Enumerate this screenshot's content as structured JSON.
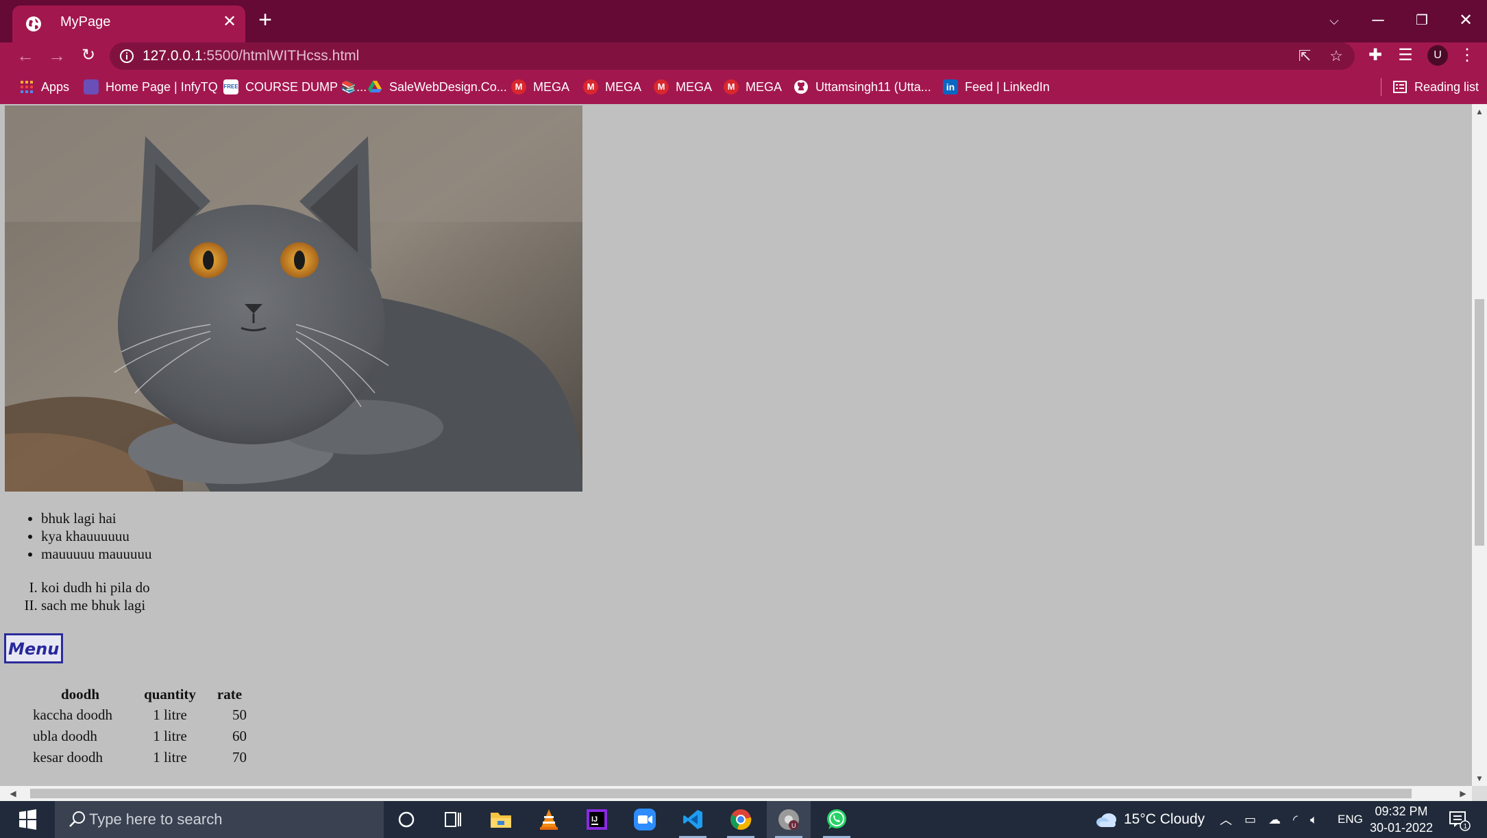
{
  "browser": {
    "tab_title": "MyPage",
    "url_host": "127.0.0.1",
    "url_rest": ":5500/htmlWITHcss.html",
    "theme_color": "#a3174f",
    "bookmarks": [
      {
        "label": "Apps",
        "icon": "apps-grid-icon"
      },
      {
        "label": "Home Page | InfyTQ",
        "icon": "infytq-icon"
      },
      {
        "label": "COURSE DUMP 📚...",
        "icon": "free-badge-icon"
      },
      {
        "label": "SaleWebDesign.Co...",
        "icon": "google-drive-icon"
      },
      {
        "label": "MEGA",
        "icon": "mega-icon"
      },
      {
        "label": "MEGA",
        "icon": "mega-icon"
      },
      {
        "label": "MEGA",
        "icon": "mega-icon"
      },
      {
        "label": "MEGA",
        "icon": "mega-icon"
      },
      {
        "label": "Uttamsingh11 (Utta...",
        "icon": "github-icon"
      },
      {
        "label": "Feed | LinkedIn",
        "icon": "linkedin-icon"
      }
    ],
    "reading_list": "Reading list",
    "profile_initial": "U"
  },
  "page": {
    "background": "#c0c0c0",
    "unordered_list": [
      "bhuk lagi hai",
      "kya khauuuuuu",
      "mauuuuu mauuuuu"
    ],
    "ordered_list": [
      "koi dudh hi pila do",
      "sach me bhuk lagi"
    ],
    "menu_heading": "Menu",
    "table": {
      "headers": [
        "doodh",
        "quantity",
        "rate"
      ],
      "rows": [
        [
          "kaccha doodh",
          "1 litre",
          "50"
        ],
        [
          "ubla doodh",
          "1 litre",
          "60"
        ],
        [
          "kesar doodh",
          "1 litre",
          "70"
        ]
      ]
    }
  },
  "taskbar": {
    "search_placeholder": "Type here to search",
    "weather": "15°C  Cloudy",
    "language": "ENG",
    "time": "09:32 PM",
    "date": "30-01-2022",
    "notification_count": "1"
  }
}
